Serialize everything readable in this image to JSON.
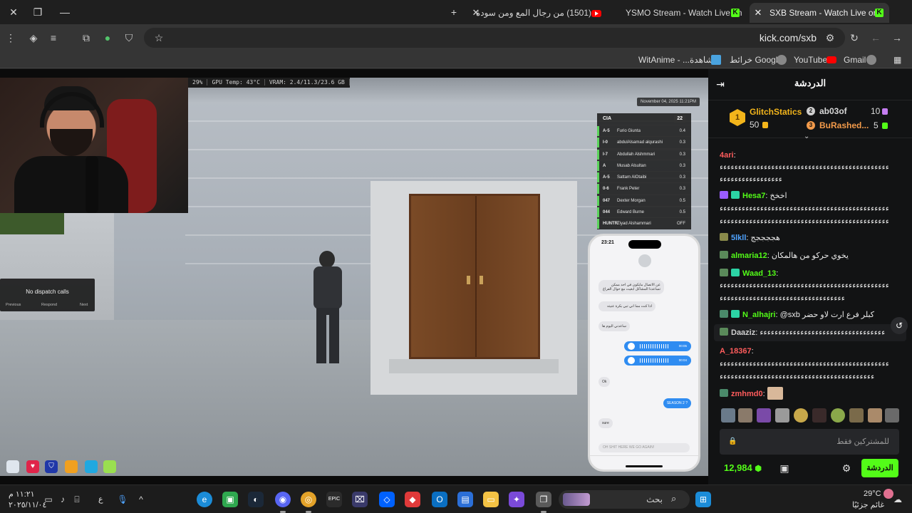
{
  "browser": {
    "tabs": [
      {
        "label": "SXB Stream - Watch Live on",
        "active": true
      },
      {
        "label": "YSMO Stream - Watch Live on",
        "active": false
      },
      {
        "label": "(1501) من رجال المع ومن سودة",
        "active": false
      }
    ],
    "new_tab": "+",
    "url": "kick.com/sxb",
    "bookmarks": [
      "Gmail",
      "YouTube",
      "خرائط Google",
      "مشاهدة... - WitAnime"
    ]
  },
  "stream": {
    "hud": [
      "29%",
      "GPU Temp: 43°C",
      "VRAM: 2.4/11.3/23.6 GB"
    ],
    "date": "November 04, 2025 11:21PM",
    "roster_title": "CIA",
    "roster_count": "22",
    "roster": [
      {
        "code": "A-5",
        "name": "Furio Giunta",
        "value": "0.4"
      },
      {
        "code": "I-0",
        "name": "abdulAlsamad alqurashi",
        "value": "0.3"
      },
      {
        "code": "I-7",
        "name": "Abdullah Alshmmari",
        "value": "0.3"
      },
      {
        "code": "A",
        "name": "Musab Alsultan",
        "value": "0.3"
      },
      {
        "code": "A-5",
        "name": "Sattam AlOtaibi",
        "value": "0.3"
      },
      {
        "code": "0-6",
        "name": "Frank Peter",
        "value": "0.3"
      },
      {
        "code": "047",
        "name": "Dexter Morgan",
        "value": "0.5"
      },
      {
        "code": "044",
        "name": "Edward Burne",
        "value": "0.5"
      },
      {
        "code": "HUNTR",
        "name": "Ziyad Alshammari",
        "value": "OFF"
      }
    ],
    "dispatch": {
      "title": "No dispatch calls",
      "previous": "Previous",
      "respond": "Respond",
      "next": "Next"
    },
    "phone": {
      "time": "23:21",
      "bubble_1": "عن الاتصال مايكون في احد ممكن تساعدنا المشاكل ابغيت مع حوال الفراغ",
      "bubble_2": "اذا كنت مما اني تبي بكرة عنيته",
      "bubble_3": "ساعدني اليوم ها",
      "voice_1": "00:05",
      "voice_2": "00:04",
      "bubble_ok": "Ok",
      "bubble_season": "SEASON 2 ?",
      "bubble_sure": "sure",
      "input": "OH SHIT HERE WE GO AGAIN!"
    }
  },
  "chat": {
    "title": "الدردشة",
    "leaderboard": [
      {
        "rank": "1",
        "name": "GlitchStatics",
        "amount": "50",
        "color": "#f3b51b"
      },
      {
        "rank": "2",
        "name": "ab03of",
        "amount": "10",
        "color": "#cfcfcf"
      },
      {
        "rank": "3",
        "name": "BuRashed...",
        "amount": "5",
        "color": "#f29a4a"
      }
    ],
    "messages": [
      {
        "user": "4ari",
        "color": "#ff5c5c",
        "text": "",
        "cont": "ﺀﺀﺀﺀﺀﺀﺀﺀﺀﺀﺀﺀﺀﺀﺀﺀﺀﺀﺀﺀﺀﺀﺀﺀﺀﺀﺀﺀﺀﺀﺀﺀﺀﺀﺀﺀﺀﺀﺀﺀﺀﺀﺀﺀﺀﺀ",
        "cont2": "ﺀﺀﺀﺀﺀﺀﺀﺀﺀﺀﺀﺀﺀﺀﺀﺀﺀ"
      },
      {
        "user": "Hesa7",
        "color": "#53fc18",
        "text": "اخخخ",
        "cont": "ﺀﺀﺀﺀﺀﺀﺀﺀﺀﺀﺀﺀﺀﺀﺀﺀﺀﺀﺀﺀﺀﺀﺀﺀﺀﺀﺀﺀﺀﺀﺀﺀﺀﺀﺀﺀﺀﺀﺀﺀﺀﺀﺀﺀﺀﺀ",
        "cont2": "ﺀﺀﺀﺀﺀﺀﺀﺀﺀﺀﺀﺀﺀﺀﺀﺀﺀﺀﺀﺀﺀﺀﺀﺀﺀﺀﺀﺀﺀﺀﺀﺀﺀﺀﺀﺀﺀﺀﺀﺀﺀﺀﺀﺀﺀﺀ"
      },
      {
        "user": "5lkll",
        "color": "#4fa3ff",
        "text": "هججججج"
      },
      {
        "user": "almaria12",
        "color": "#53fc18",
        "text": "يخوي حركو من هالمكان"
      },
      {
        "user": "Waad_13",
        "color": "#53fc18",
        "text": "",
        "cont": "ﺀﺀﺀﺀﺀﺀﺀﺀﺀﺀﺀﺀﺀﺀﺀﺀﺀﺀﺀﺀﺀﺀﺀﺀﺀﺀﺀﺀﺀﺀﺀﺀﺀﺀﺀﺀﺀﺀﺀﺀﺀﺀﺀﺀﺀﺀ",
        "cont2": "ﺀﺀﺀﺀﺀﺀﺀﺀﺀﺀﺀﺀﺀﺀﺀﺀﺀﺀﺀﺀﺀﺀﺀﺀﺀﺀﺀﺀﺀﺀﺀﺀﺀﺀ"
      },
      {
        "user": "N_alhajri",
        "color": "#53fc18",
        "text": "@sxb كبلر فرع ارت لاو حضر"
      },
      {
        "user": "Daaziz",
        "color": "#cfcfcf",
        "text": "ﺀﺀﺀﺀﺀﺀﺀﺀﺀﺀﺀﺀﺀﺀﺀﺀﺀﺀﺀﺀﺀﺀﺀﺀﺀﺀﺀﺀﺀﺀﺀﺀﺀﺀ"
      },
      {
        "user": "A_18367",
        "color": "#ff5c5c",
        "text": "",
        "cont": "ﺀﺀﺀﺀﺀﺀﺀﺀﺀﺀﺀﺀﺀﺀﺀﺀﺀﺀﺀﺀﺀﺀﺀﺀﺀﺀﺀﺀﺀﺀﺀﺀﺀﺀﺀﺀﺀﺀﺀﺀﺀﺀﺀﺀﺀﺀ",
        "cont2": "ﺀﺀﺀﺀﺀﺀﺀﺀﺀﺀﺀﺀﺀﺀﺀﺀﺀﺀﺀﺀﺀﺀﺀﺀﺀﺀﺀﺀﺀﺀﺀﺀﺀﺀﺀﺀﺀﺀﺀﺀﺀﺀ"
      },
      {
        "user": "zmhmd0",
        "color": "#ff5c5c",
        "text": ""
      }
    ],
    "input_placeholder": "للمشتركين فقط",
    "send_label": "الدردشة",
    "points": "12,984"
  },
  "taskbar": {
    "search": "بحث",
    "weather_temp": "29°C",
    "weather_text": "غائم جزئيًا",
    "time": "١١:٢١ م",
    "date": "٢٠٢٥/١١/٠٤",
    "lang": "ع"
  },
  "colors": {
    "kick_green": "#53fc18",
    "chat_bg": "#121314",
    "browser_bg": "#1f1f1f"
  }
}
